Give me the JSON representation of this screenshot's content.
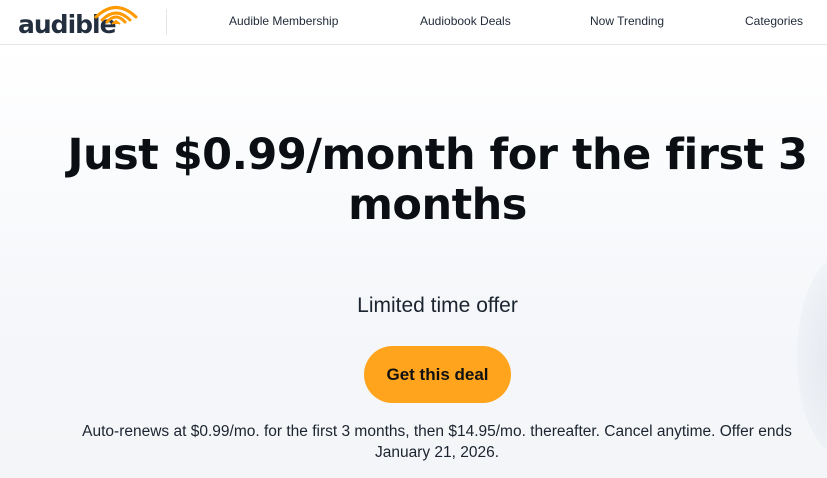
{
  "brand": {
    "logo_text": "audible",
    "accent_color": "#ff9a00",
    "cta_color": "#ffa41c"
  },
  "nav": {
    "items": [
      {
        "label": "Audible Membership"
      },
      {
        "label": "Audiobook Deals"
      },
      {
        "label": "Now Trending"
      },
      {
        "label": "Categories"
      }
    ]
  },
  "hero": {
    "headline": "Just $0.99/month for the first 3 months",
    "subhead": "Limited time offer",
    "cta_label": "Get this deal",
    "fineprint": "Auto-renews at $0.99/mo. for the first 3 months, then $14.95/mo. thereafter. Cancel anytime. Offer ends January 21, 2026."
  }
}
